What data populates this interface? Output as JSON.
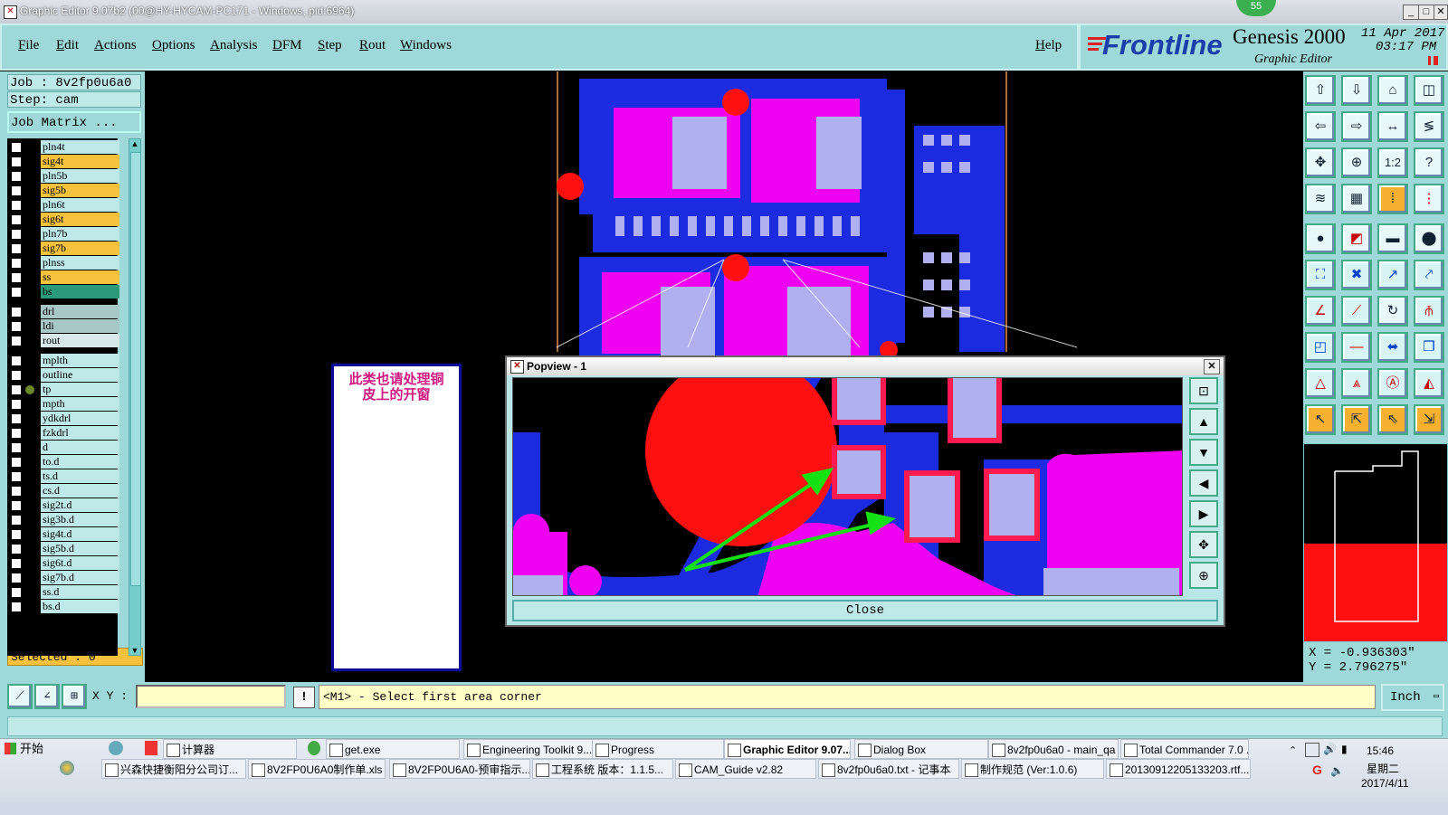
{
  "titlebar": {
    "title": "Graphic Editor 9.07b2 (00@HY-HYCAM-PC171 - Windows, pid:6964)",
    "badge": "55"
  },
  "menu": {
    "items": [
      "File",
      "Edit",
      "Actions",
      "Options",
      "Analysis",
      "DFM",
      "Step",
      "Rout",
      "Windows"
    ],
    "help": "Help"
  },
  "brand": {
    "logo": "Frontline",
    "product": "Genesis 2000",
    "subtitle": "Graphic Editor",
    "date": "11 Apr 2017",
    "time": "03:17 PM"
  },
  "job": {
    "job_label": "Job : 8v2fp0u6a0",
    "step_label": "Step: cam",
    "matrix_button": "Job Matrix ..."
  },
  "layers": [
    {
      "name": "pln4t",
      "color": "#bfe9e9"
    },
    {
      "name": "sig4t",
      "color": "#f6c23e"
    },
    {
      "name": "pln5b",
      "color": "#bfe9e9"
    },
    {
      "name": "sig5b",
      "color": "#f6c23e"
    },
    {
      "name": "pln6t",
      "color": "#bfe9e9"
    },
    {
      "name": "sig6t",
      "color": "#f6c23e"
    },
    {
      "name": "pln7b",
      "color": "#bfe9e9"
    },
    {
      "name": "sig7b",
      "color": "#f6c23e"
    },
    {
      "name": "plnss",
      "color": "#bfe9e9"
    },
    {
      "name": "ss",
      "color": "#f6c23e"
    },
    {
      "name": "bs",
      "color": "#2a9a7a"
    },
    {
      "name": "drl",
      "color": "#a8c8c8"
    },
    {
      "name": "ldi",
      "color": "#a8c8c8"
    },
    {
      "name": "rout",
      "color": "#d8e8e8"
    },
    {
      "name": "mplth",
      "color": "#bfe9e9"
    },
    {
      "name": "outline",
      "color": "#bfe9e9"
    },
    {
      "name": "tp",
      "color": "#bfe9e9",
      "active": true
    },
    {
      "name": "mpth",
      "color": "#bfe9e9"
    },
    {
      "name": "ydkdrl",
      "color": "#bfe9e9"
    },
    {
      "name": "fzkdrl",
      "color": "#bfe9e9"
    },
    {
      "name": "d",
      "color": "#bfe9e9"
    },
    {
      "name": "to.d",
      "color": "#bfe9e9"
    },
    {
      "name": "ts.d",
      "color": "#bfe9e9"
    },
    {
      "name": "cs.d",
      "color": "#bfe9e9"
    },
    {
      "name": "sig2t.d",
      "color": "#bfe9e9"
    },
    {
      "name": "sig3b.d",
      "color": "#bfe9e9"
    },
    {
      "name": "sig4t.d",
      "color": "#bfe9e9"
    },
    {
      "name": "sig5b.d",
      "color": "#bfe9e9"
    },
    {
      "name": "sig6t.d",
      "color": "#bfe9e9"
    },
    {
      "name": "sig7b.d",
      "color": "#bfe9e9"
    },
    {
      "name": "ss.d",
      "color": "#bfe9e9"
    },
    {
      "name": "bs.d",
      "color": "#bfe9e9"
    }
  ],
  "selected_label": "Selected : 0",
  "annotation_note": "此类也请处理铜皮上的开窗",
  "popup": {
    "title": "Popview - 1",
    "close_label": "Close"
  },
  "coords": {
    "x": "X = -0.936303\"",
    "y": "Y = 2.796275\""
  },
  "cmd": {
    "xy_label": "X Y :",
    "xy_value": "",
    "prompt": "<M1> - Select first area corner",
    "units": "Inch"
  },
  "taskbar": {
    "start": "开始",
    "row1": [
      "计算器",
      "get.exe",
      "Engineering Toolkit 9....",
      "Progress",
      "Graphic Editor 9.07...",
      "Dialog Box",
      "8v2fp0u6a0 - main_qa",
      "Total Commander 7.0 ..."
    ],
    "row2": [
      "兴森快捷衡阳分公司订...",
      "8V2FP0U6A0制作单.xls ...",
      "8V2FP0U6A0-预审指示...",
      "工程系统  版本：1.1.5...",
      "CAM_Guide v2.82",
      "8v2fp0u6a0.txt - 记事本",
      "制作规范 (Ver:1.0.6)",
      "20130912205133203.rtf..."
    ],
    "clock_time": "15:46",
    "clock_day": "星期二",
    "clock_date": "2017/4/11"
  }
}
